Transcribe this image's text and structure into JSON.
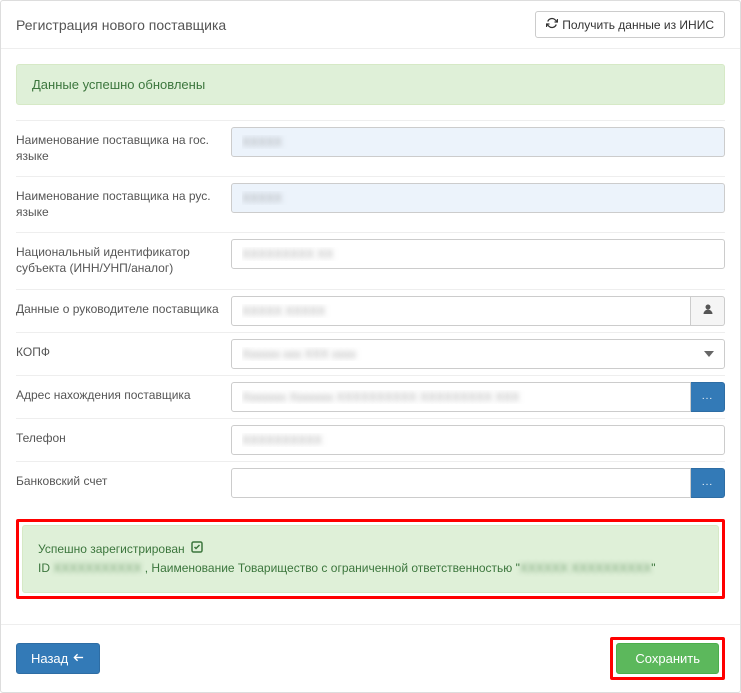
{
  "header": {
    "title": "Регистрация нового поставщика",
    "refresh_button": "Получить данные из ИНИС"
  },
  "alerts": {
    "updated": "Данные успешно обновлены",
    "registered_prefix": "Успешно зарегистрирован",
    "registered_id_label": "ID",
    "registered_id_value": "XXXXXXXXXXX",
    "registered_name_prefix": ", Наименование Товарищество с ограниченной ответственностью \"",
    "registered_name_value": "XXXXXX XXXXXXXXXX",
    "registered_name_suffix": "\""
  },
  "form": {
    "name_gov": {
      "label": "Наименование поставщика на гос. языке",
      "value": "XXXXX"
    },
    "name_rus": {
      "label": "Наименование поставщика на рус. языке",
      "value": "XXXXX"
    },
    "national_id": {
      "label": "Национальный идентификатор субъекта (ИНН/УНП/аналог)",
      "value": "XXXXXXXXX XX"
    },
    "manager": {
      "label": "Данные о руководителе поставщика",
      "value": "XXXXX XXXXX"
    },
    "kopf": {
      "label": "КОПФ",
      "value": "Xxxxxx xxx XXX xxxx"
    },
    "address": {
      "label": "Адрес нахождения поставщика",
      "value": "Xxxxxxx Xxxxxxx XXXXXXXXXX XXXXXXXXX XXX"
    },
    "phone": {
      "label": "Телефон",
      "value": "XXXXXXXXXX"
    },
    "bank": {
      "label": "Банковский счет",
      "value": ""
    }
  },
  "footer": {
    "back": "Назад",
    "save": "Сохранить"
  }
}
